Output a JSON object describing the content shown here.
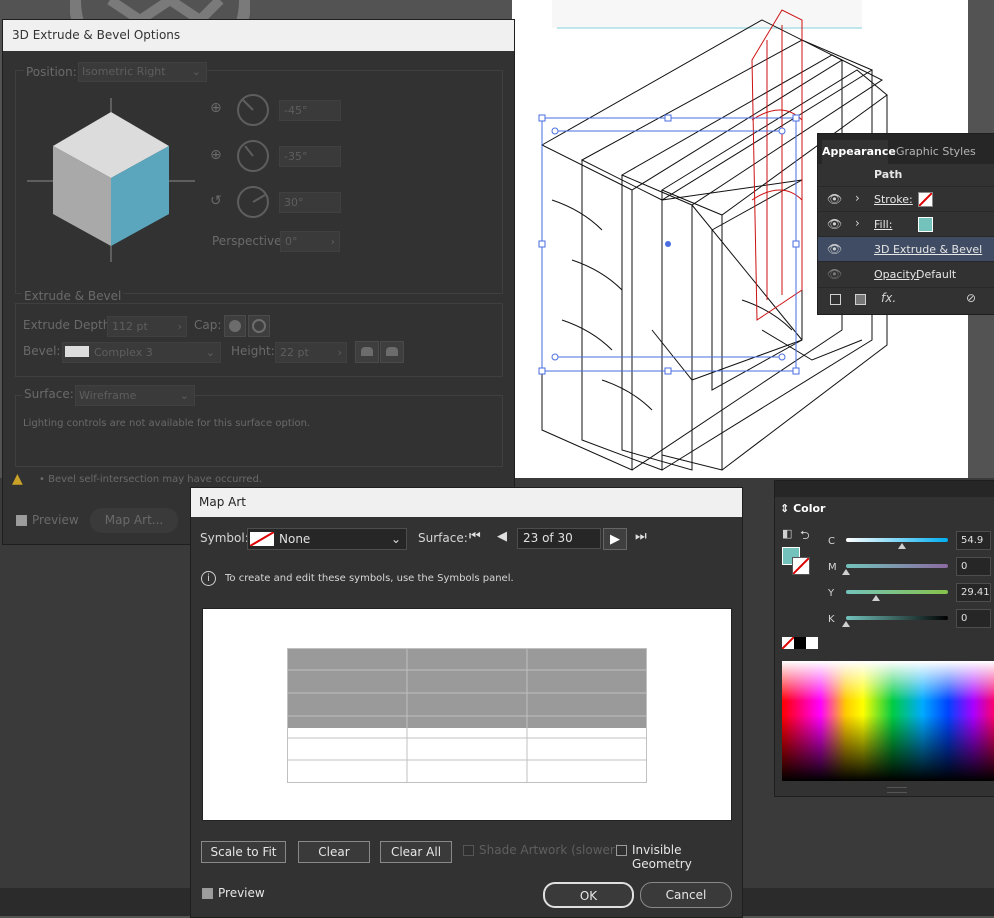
{
  "dialog3d": {
    "title": "3D Extrude & Bevel Options",
    "position_label": "Position:",
    "position_value": "Isometric Right",
    "rot_x": "-45°",
    "rot_y": "-35°",
    "rot_z": "30°",
    "perspective_label": "Perspective:",
    "perspective_value": "0°",
    "extrude_section": "Extrude & Bevel",
    "extrude_depth_label": "Extrude Depth:",
    "extrude_depth_value": "112 pt",
    "cap_label": "Cap:",
    "bevel_label": "Bevel:",
    "bevel_value": "Complex 3",
    "height_label": "Height:",
    "height_value": "22 pt",
    "surface_label": "Surface:",
    "surface_value": "Wireframe",
    "lighting_note": "Lighting controls are not available for this surface option.",
    "warning": "• Bevel self-intersection may have occurred.",
    "preview_label": "Preview",
    "map_art_button": "Map Art..."
  },
  "mapart": {
    "title": "Map Art",
    "symbol_label": "Symbol:",
    "symbol_value": "None",
    "surface_label": "Surface:",
    "surface_value": "23 of 30",
    "info_text": "To create and edit these symbols, use the Symbols panel.",
    "scale_to_fit": "Scale to Fit",
    "clear": "Clear",
    "clear_all": "Clear All",
    "shade_artwork": "Shade Artwork (slower)",
    "invisible_geometry": "Invisible Geometry",
    "preview_label": "Preview",
    "ok": "OK",
    "cancel": "Cancel"
  },
  "appearance": {
    "tab_active": "Appearance",
    "tab_other": "Graphic Styles",
    "header": "Path",
    "rows": [
      {
        "label": "Stroke:"
      },
      {
        "label": "Fill:"
      },
      {
        "label": "3D Extrude & Bevel"
      },
      {
        "label": "Opacity:",
        "value": "Default"
      }
    ],
    "fx_label": "fx."
  },
  "color": {
    "title": "Color",
    "channels": [
      {
        "name": "C",
        "value": "54.9",
        "level": 0.549
      },
      {
        "name": "M",
        "value": "0",
        "level": 0
      },
      {
        "name": "Y",
        "value": "29.41",
        "level": 0.294
      },
      {
        "name": "K",
        "value": "0",
        "level": 0
      }
    ],
    "fill_color": "#73c3bc",
    "accent_blue": "#5ba6bd"
  }
}
